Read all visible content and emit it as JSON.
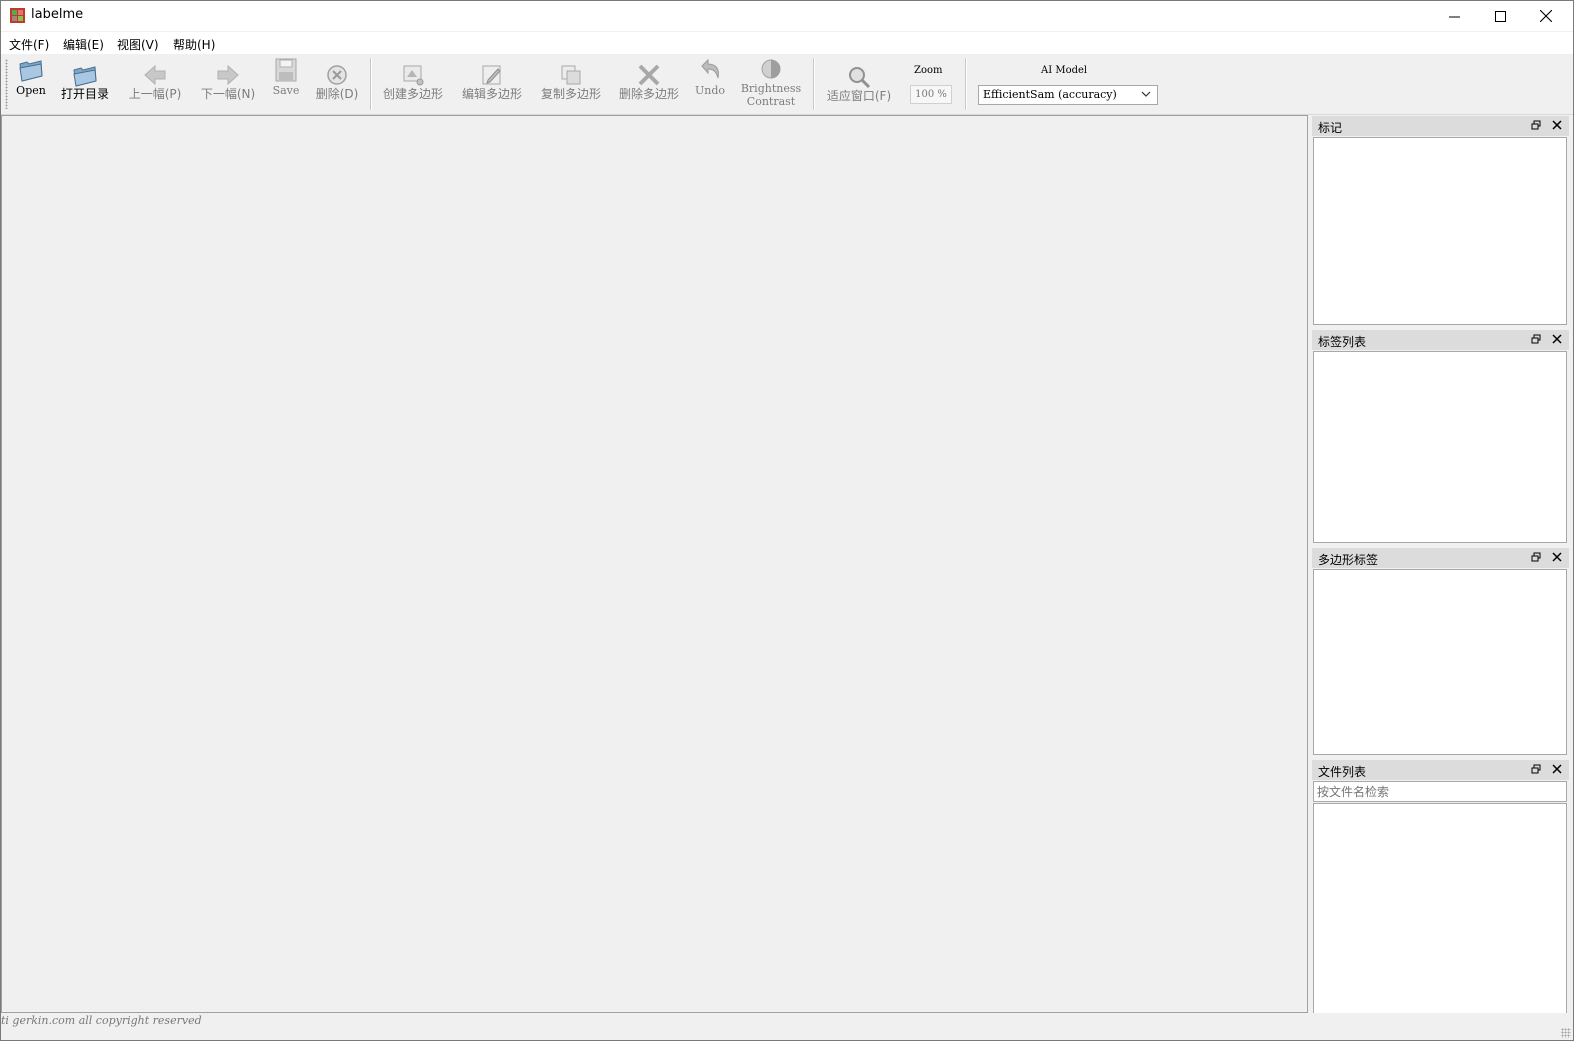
{
  "window": {
    "title": "labelme",
    "controls": {
      "minimize_icon": "minimize-icon",
      "maximize_icon": "maximize-icon",
      "close_icon": "close-icon"
    }
  },
  "menu": {
    "items": [
      "文件(F)",
      "编辑(E)",
      "视图(V)",
      "帮助(H)"
    ]
  },
  "toolbar": {
    "open": "Open",
    "open_dir": "打开目录",
    "prev": "上一幅(P)",
    "next": "下一幅(N)",
    "save": "Save",
    "delete_file": "删除(D)",
    "create_polygon": "创建多边形",
    "edit_polygon": "编辑多边形",
    "duplicate_polygon": "复制多边形",
    "delete_polygon": "删除多边形",
    "undo": "Undo",
    "brightness_line1": "Brightness",
    "brightness_line2": "Contrast",
    "fit_window": "适应窗口(F)",
    "zoom_label": "Zoom",
    "zoom_value": "100 %",
    "ai_model_label": "AI Model",
    "ai_model_value": "EfficientSam (accuracy)"
  },
  "docks": {
    "flags": {
      "title": "标记"
    },
    "label_list": {
      "title": "标签列表"
    },
    "polygon_labels": {
      "title": "多边形标签"
    },
    "file_list": {
      "title": "文件列表",
      "search_placeholder": "按文件名检索"
    }
  },
  "status": {
    "watermark": "ti gerkin.com all copyright reserved"
  },
  "colors": {
    "window_bg": "#f0f0f0",
    "dock_title_bg": "#dcdcdc",
    "disabled_text": "#7d7d7d"
  }
}
